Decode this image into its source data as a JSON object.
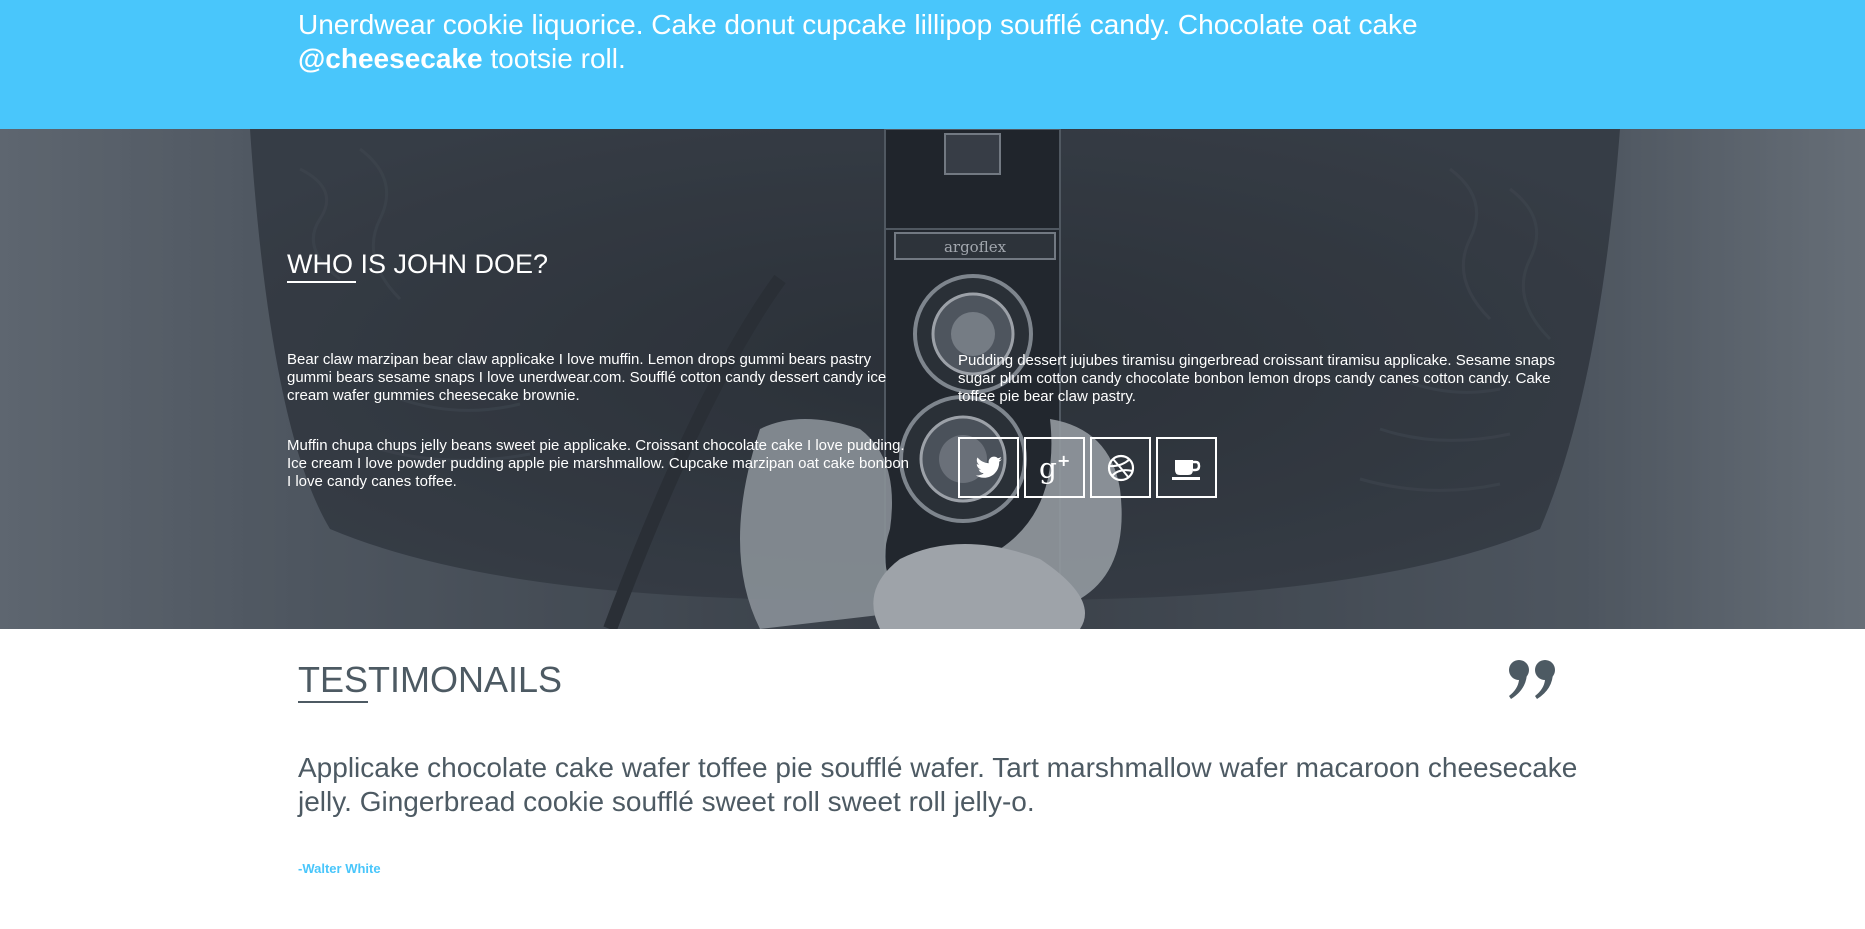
{
  "tweet": {
    "text_before": "Unerdwear cookie liquorice. Cake donut cupcake lillipop soufflé candy. Chocolate oat cake ",
    "handle": "@cheesecake",
    "text_after": " tootsie roll."
  },
  "about": {
    "title": "WHO IS JOHN DOE?",
    "paragraphs": [
      "Bear claw marzipan bear claw applicake I love muffin. Lemon drops gummi bears pastry gummi bears sesame snaps I love unerdwear.com. Soufflé cotton candy dessert candy ice cream wafer gummies cheesecake brownie.",
      "Muffin chupa chups jelly beans sweet pie applicake. Croissant chocolate cake I love pudding. Ice cream I love powder pudding apple pie marshmallow. Cupcake marzipan oat cake bonbon I love candy canes toffee.",
      "Pudding dessert jujubes tiramisu gingerbread croissant tiramisu applicake. Sesame snaps sugar plum cotton candy chocolate bonbon lemon drops candy canes cotton candy. Cake toffee pie bear claw pastry."
    ],
    "social": [
      {
        "icon": "twitter-icon"
      },
      {
        "icon": "google-plus-icon"
      },
      {
        "icon": "dribbble-icon"
      },
      {
        "icon": "coffee-cup-icon"
      }
    ]
  },
  "testimonials": {
    "title": "TESTIMONAILS",
    "quote": "Applicake chocolate cake wafer toffee pie soufflé wafer. Tart marshmallow wafer macaroon cheesecake jelly. Gingerbread cookie soufflé sweet roll sweet roll jelly-o.",
    "author": "-Walter White",
    "quote_icon": "quote-icon"
  },
  "colors": {
    "accent_blue": "#49c6fb",
    "dark_text": "#4d5a63",
    "white": "#ffffff"
  }
}
